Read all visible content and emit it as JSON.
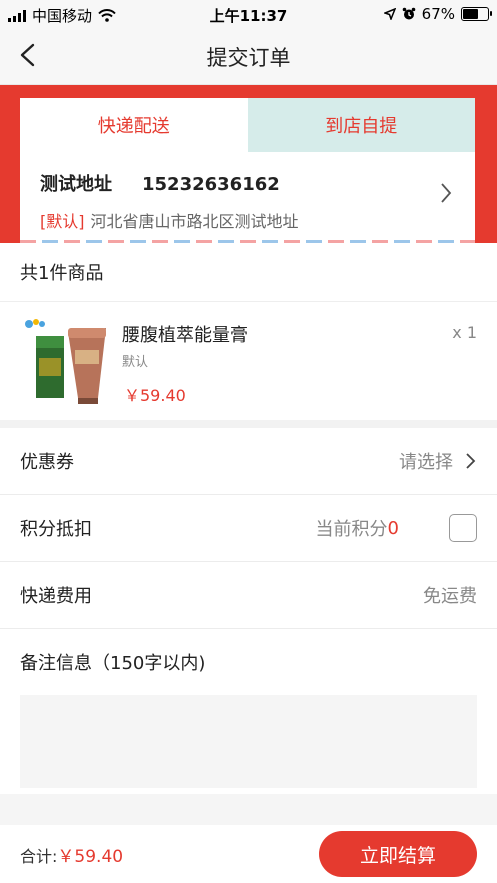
{
  "status_bar": {
    "carrier": "中国移动",
    "time": "上午11:37",
    "battery_text": "67%",
    "battery_level": 0.67
  },
  "nav": {
    "title": "提交订单"
  },
  "delivery": {
    "tabs": [
      {
        "label": "快递配送"
      },
      {
        "label": "到店自提"
      }
    ],
    "selected_index": 0
  },
  "address": {
    "name": "测试地址",
    "phone": "15232636162",
    "default_tag": "[默认]",
    "detail": "河北省唐山市路北区测试地址"
  },
  "goods": {
    "header": "共1件商品",
    "items": [
      {
        "name": "腰腹植萃能量膏",
        "spec": "默认",
        "price": "￥59.40",
        "qty": "x 1"
      }
    ]
  },
  "options": {
    "coupon": {
      "label": "优惠券",
      "value": "请选择"
    },
    "points": {
      "label": "积分抵扣",
      "prefix": "当前积分",
      "value": "0"
    },
    "shipping": {
      "label": "快递费用",
      "value": "免运费"
    }
  },
  "remark": {
    "label": "备注信息（150字以内)",
    "value": ""
  },
  "footer": {
    "total_label": "合计:",
    "total_price": "￥59.40",
    "submit_label": "立即结算"
  },
  "colors": {
    "accent": "#e53a2f",
    "tab_inactive_bg": "#d6ecea"
  },
  "icons": [
    "signal-icon",
    "wifi-icon",
    "location-arrow-icon",
    "alarm-icon",
    "battery-icon",
    "back-chevron-icon",
    "chevron-right-icon",
    "checkbox-icon"
  ]
}
